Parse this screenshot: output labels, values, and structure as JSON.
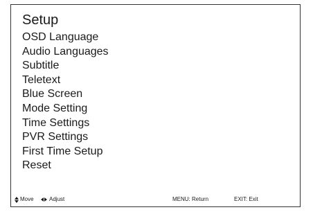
{
  "menu": {
    "title": "Setup",
    "items": [
      "OSD Language",
      "Audio Languages",
      "Subtitle",
      "Teletext",
      "Blue Screen",
      "Mode Setting",
      "Time Settings",
      "PVR Settings",
      "First Time Setup",
      "Reset"
    ]
  },
  "hints": {
    "move": {
      "icon": "up-down-arrows-icon",
      "label": "Move"
    },
    "adjust": {
      "icon": "left-right-arrows-icon",
      "label": "Adjust"
    },
    "return": {
      "label": "MENU: Return"
    },
    "exit": {
      "label": "EXIT: Exit"
    }
  },
  "colors": {
    "background": "#ffffff",
    "text": "#1a1a1a",
    "border": "#333333"
  }
}
